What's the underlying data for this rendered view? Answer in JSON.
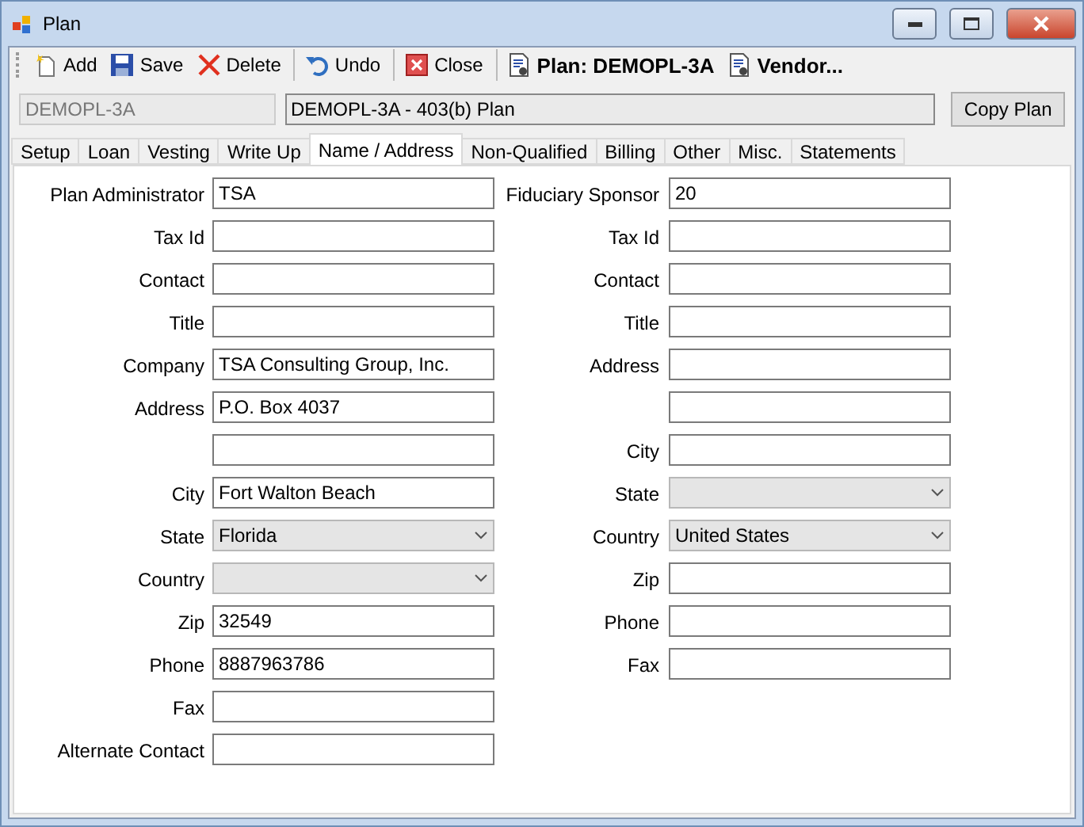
{
  "window": {
    "title": "Plan"
  },
  "toolbar": [
    {
      "label": "Add",
      "kind": "add",
      "bold": false,
      "separator_before": false
    },
    {
      "label": "Save",
      "kind": "save",
      "bold": false,
      "separator_before": false
    },
    {
      "label": "Delete",
      "kind": "delete",
      "bold": false,
      "separator_before": false
    },
    {
      "label": "Undo",
      "kind": "undo",
      "bold": false,
      "separator_before": true
    },
    {
      "label": "Close",
      "kind": "close",
      "bold": false,
      "separator_before": true
    },
    {
      "label": "Plan: DEMOPL-3A",
      "kind": "report",
      "bold": true,
      "separator_before": true
    },
    {
      "label": "Vendor...",
      "kind": "report",
      "bold": true,
      "separator_before": false
    }
  ],
  "header": {
    "plan_code": {
      "value": "DEMOPL-3A",
      "disabled": true
    },
    "plan_name": {
      "value": "DEMOPL-3A  - 403(b) Plan",
      "disabled": false
    },
    "button": "Copy Plan"
  },
  "tabs": [
    {
      "label": "Setup",
      "selected": false
    },
    {
      "label": "Loan",
      "selected": false
    },
    {
      "label": "Vesting",
      "selected": false
    },
    {
      "label": "Write Up",
      "selected": false
    },
    {
      "label": "Name / Address",
      "selected": true
    },
    {
      "label": "Non-Qualified",
      "selected": false
    },
    {
      "label": "Billing",
      "selected": false
    },
    {
      "label": "Other",
      "selected": false
    },
    {
      "label": "Misc.",
      "selected": false
    },
    {
      "label": "Statements",
      "selected": false
    }
  ],
  "left_fields": [
    {
      "label": "Plan Administrator",
      "kind": "text",
      "value": "TSA"
    },
    {
      "label": "Tax Id",
      "kind": "text"
    },
    {
      "label": "Contact",
      "kind": "text"
    },
    {
      "label": "Title",
      "kind": "text"
    },
    {
      "label": "Company",
      "kind": "text",
      "value": "TSA Consulting Group, Inc."
    },
    {
      "label": "Address",
      "kind": "text",
      "value": "P.O. Box 4037"
    },
    {
      "kind": "text"
    },
    {
      "label": "City",
      "kind": "text",
      "value": "Fort Walton Beach"
    },
    {
      "label": "State",
      "kind": "combo",
      "value": "Florida"
    },
    {
      "label": "Country",
      "kind": "combo"
    },
    {
      "label": "Zip",
      "kind": "text",
      "value": "32549"
    },
    {
      "label": "Phone",
      "kind": "text",
      "value": "8887963786"
    },
    {
      "label": "Fax",
      "kind": "text"
    },
    {
      "label": "Alternate Contact",
      "kind": "text"
    }
  ],
  "right_fields": [
    {
      "label": "Fiduciary Sponsor",
      "kind": "text",
      "value": "20"
    },
    {
      "label": "Tax Id",
      "kind": "text"
    },
    {
      "label": "Contact",
      "kind": "text"
    },
    {
      "label": "Title",
      "kind": "text"
    },
    {
      "label": "Address",
      "kind": "text"
    },
    {
      "kind": "text"
    },
    {
      "label": "City",
      "kind": "text"
    },
    {
      "label": "State",
      "kind": "combo"
    },
    {
      "label": "Country",
      "kind": "combo",
      "value": "United States"
    },
    {
      "label": "Zip",
      "kind": "text"
    },
    {
      "label": "Phone",
      "kind": "text"
    },
    {
      "label": "Fax",
      "kind": "text"
    }
  ]
}
